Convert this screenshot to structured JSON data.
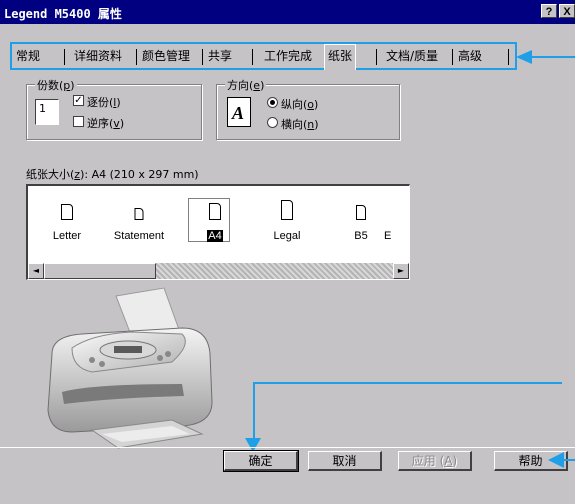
{
  "window": {
    "title": "Legend M5400 属性",
    "help_glyph": "?",
    "close_glyph": "X"
  },
  "tabs": [
    {
      "label": "常规"
    },
    {
      "label": "详细资料"
    },
    {
      "label": "颜色管理"
    },
    {
      "label": "共享"
    },
    {
      "label": "工作完成"
    },
    {
      "label": "纸张",
      "active": true
    },
    {
      "label": "文档/质量"
    },
    {
      "label": "高级"
    }
  ],
  "copies": {
    "group_label": "份数",
    "hotkey": "p",
    "value": "1",
    "collate_label": "逐份",
    "collate_hotkey": "l",
    "collate_checked": true,
    "reverse_label": "逆序",
    "reverse_hotkey": "v",
    "reverse_checked": false
  },
  "orientation": {
    "group_label": "方向",
    "hotkey": "e",
    "icon_letter": "A",
    "portrait_label": "纵向",
    "portrait_hotkey": "o",
    "landscape_label": "横向",
    "landscape_hotkey": "n",
    "selected": "portrait"
  },
  "paper": {
    "size_label": "纸张大小",
    "size_hotkey": "z",
    "size_value": ": A4 (210 x 297 mm)",
    "items": [
      {
        "name": "Letter"
      },
      {
        "name": "Statement"
      },
      {
        "name": "A4",
        "selected": true
      },
      {
        "name": "Legal"
      },
      {
        "name": "B5"
      },
      {
        "name": "E"
      }
    ],
    "scroll_left": "◄",
    "scroll_right": "►"
  },
  "buttons": {
    "ok": "确定",
    "cancel": "取消",
    "apply": "应用",
    "apply_hotkey": "A",
    "help": "帮助"
  },
  "colors": {
    "titlebar": "#000080",
    "dialog": "#c6c3c6",
    "callout": "#1e9fe8"
  },
  "icons": {
    "printer_image": "printer-image",
    "orientation": "portrait-page-icon",
    "paper": "paper-sheet-icon"
  }
}
